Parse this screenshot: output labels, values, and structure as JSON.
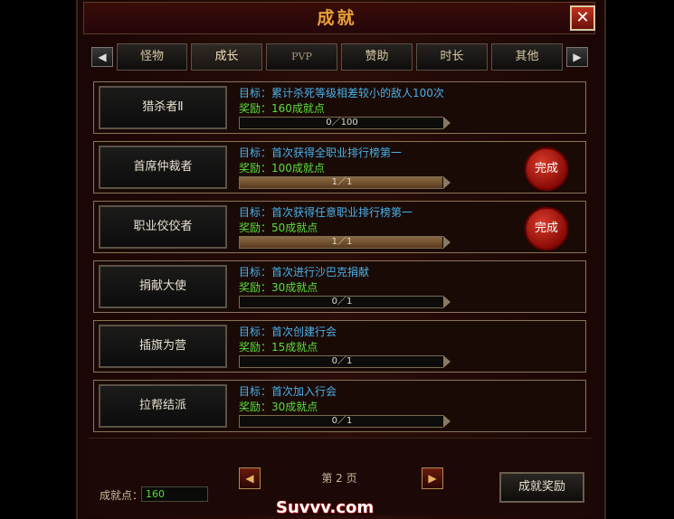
{
  "window": {
    "title": "成就",
    "close_label": "✕"
  },
  "tabs": {
    "prev_icon": "◀",
    "next_icon": "▶",
    "items": [
      {
        "label": "怪物",
        "active": false
      },
      {
        "label": "成长",
        "active": true
      },
      {
        "label": "PVP",
        "active": false
      },
      {
        "label": "赞助",
        "active": false
      },
      {
        "label": "时长",
        "active": false
      },
      {
        "label": "其他",
        "active": false
      }
    ]
  },
  "achievements": [
    {
      "name": "猎杀者Ⅱ",
      "goal": "目标：累计杀死等级相差较小的敌人100次",
      "reward": "奖励：160成就点",
      "progress": "0／100",
      "progress_fraction": 0.0,
      "completed": false
    },
    {
      "name": "首席仲裁者",
      "goal": "目标：首次获得全职业排行榜第一",
      "reward": "奖励：100成就点",
      "progress": "1／1",
      "progress_fraction": 1.0,
      "completed": true
    },
    {
      "name": "职业佼佼者",
      "goal": "目标：首次获得任意职业排行榜第一",
      "reward": "奖励：50成就点",
      "progress": "1／1",
      "progress_fraction": 1.0,
      "completed": true
    },
    {
      "name": "捐献大使",
      "goal": "目标：首次进行沙巴克捐献",
      "reward": "奖励：30成就点",
      "progress": "0／1",
      "progress_fraction": 0.0,
      "completed": false
    },
    {
      "name": "插旗为营",
      "goal": "目标：首次创建行会",
      "reward": "奖励：15成就点",
      "progress": "0／1",
      "progress_fraction": 0.0,
      "completed": false
    },
    {
      "name": "拉帮结派",
      "goal": "目标：首次加入行会",
      "reward": "奖励：30成就点",
      "progress": "0／1",
      "progress_fraction": 0.0,
      "completed": false
    }
  ],
  "completed_seal_label": "完成",
  "pagination": {
    "prev_icon": "◀",
    "next_icon": "▶",
    "label": "第 2 页"
  },
  "footer": {
    "points_label": "成就点：",
    "points_value": "160",
    "reward_button": "成就奖励"
  },
  "watermark": "Suvvv.com",
  "colors": {
    "accent_title": "#e8a038",
    "goal_text": "#4ab0e8",
    "reward_text": "#5ade3a",
    "seal_red": "#b8140c"
  }
}
